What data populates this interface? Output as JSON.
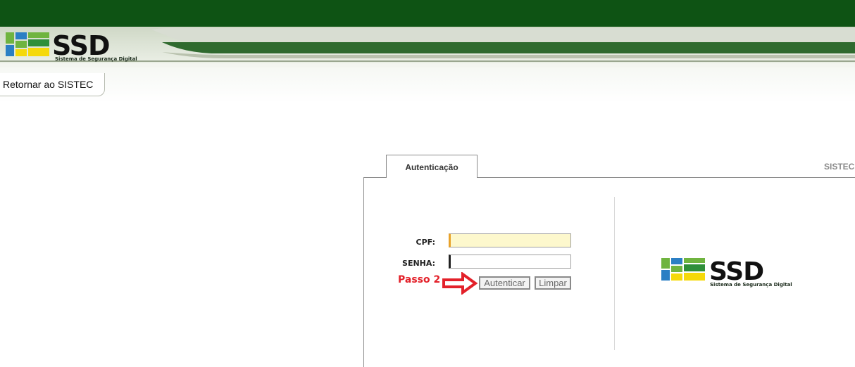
{
  "header": {
    "brand_name": "SSD",
    "brand_tagline": "Sistema de Segurança Digital",
    "colors": {
      "top_bar": "#0e5314",
      "band": "#2f6a2e",
      "logo_green": "#6fb43f",
      "logo_blue": "#2b7fc4",
      "logo_yellow": "#f5d90a"
    }
  },
  "nav": {
    "return_label": "Retornar ao SISTEC"
  },
  "tabs": [
    {
      "label": "Autenticação",
      "active": true
    },
    {
      "label": "SISTEC",
      "active": false
    }
  ],
  "form": {
    "cpf_label": "CPF:",
    "cpf_value": "",
    "senha_label": "SENHA:",
    "senha_value": "",
    "step_label": "Passo 2",
    "authenticate_label": "Autenticar",
    "clear_label": "Limpar"
  },
  "side_logo": {
    "brand_name": "SSD",
    "brand_tagline": "Sistema de Segurança Digital"
  }
}
